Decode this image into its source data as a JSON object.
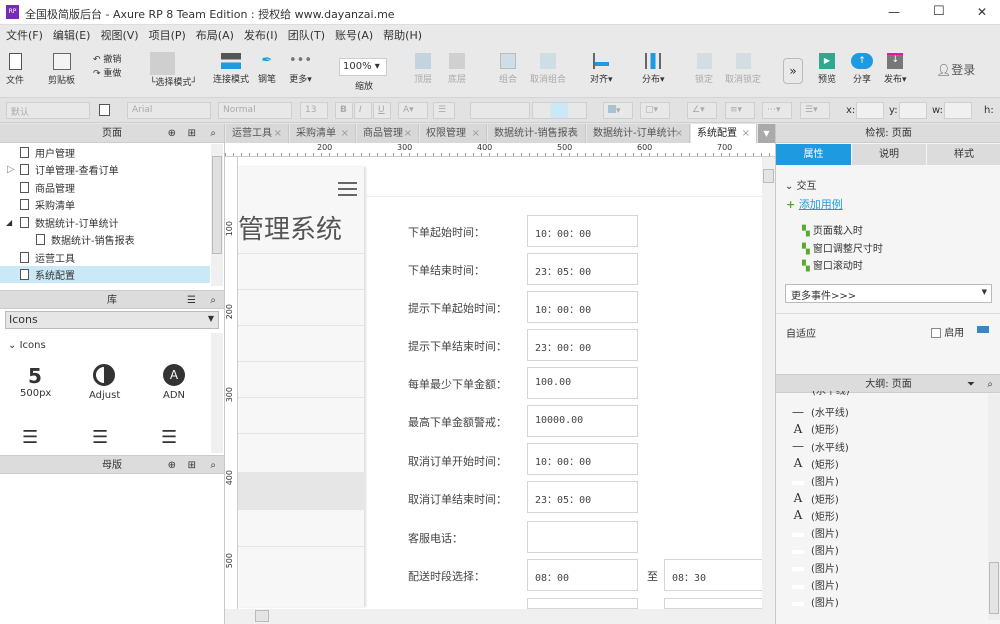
{
  "window": {
    "title": "全国极简版后台 - Axure RP 8 Team Edition : 授权给 www.dayanzai.me",
    "minimize": "—",
    "maximize": "☐",
    "close": "✕"
  },
  "menu": [
    "文件(F)",
    "编辑(E)",
    "视图(V)",
    "项目(P)",
    "布局(A)",
    "发布(I)",
    "团队(T)",
    "账号(A)",
    "帮助(H)"
  ],
  "toolbar": {
    "file": "文件",
    "clipboard": "剪贴板",
    "undo": "撤销",
    "redo": "重做",
    "select_mode": "选择模式",
    "connect_mode": "连接模式",
    "pen": "钢笔",
    "more": "更多▾",
    "zoom_value": "100%",
    "zoom": "缩放",
    "top": "顶层",
    "bottom": "底层",
    "group": "组合",
    "ungroup": "取消组合",
    "align": "对齐▾",
    "distribute": "分布▾",
    "lock": "锁定",
    "unlock": "取消锁定",
    "preview": "预览",
    "share": "分享",
    "publish": "发布▾",
    "login": "登录"
  },
  "format": {
    "style": "默认",
    "font": "Arial",
    "weight": "Normal",
    "size": "13",
    "x": "x:",
    "y": "y:",
    "w": "w:",
    "h": "h:"
  },
  "pages": {
    "title": "页面",
    "items": [
      "用户管理",
      "订单管理-查看订单",
      "商品管理",
      "采购清单",
      "数据统计-订单统计",
      "数据统计-销售报表",
      "运营工具",
      "系统配置"
    ]
  },
  "library": {
    "title": "库",
    "selected": "Icons",
    "group": "Icons",
    "icons": [
      "500px",
      "Adjust",
      "ADN"
    ]
  },
  "masters": {
    "title": "母版"
  },
  "tabs": [
    "运营工具",
    "采购清单",
    "商品管理",
    "权限管理",
    "数据统计-销售报表",
    "数据统计-订单统计",
    "系统配置"
  ],
  "ruler": {
    "h": [
      "200",
      "300",
      "400",
      "500",
      "600",
      "700"
    ],
    "v": [
      "100",
      "200",
      "300",
      "400",
      "500"
    ]
  },
  "canvas": {
    "sidebar_title": "管理系统",
    "form": [
      {
        "label": "下单起始时间：",
        "value": "10：00：00"
      },
      {
        "label": "下单结束时间：",
        "value": "23：05：00"
      },
      {
        "label": "提示下单起始时间：",
        "value": "10：00：00"
      },
      {
        "label": "提示下单结束时间：",
        "value": "23：00：00"
      },
      {
        "label": "每单最少下单金额：",
        "value": "100.00"
      },
      {
        "label": "最高下单金额警戒：",
        "value": "10000.00"
      },
      {
        "label": "取消订单开始时间：",
        "value": "10：00：00"
      },
      {
        "label": "取消订单结束时间：",
        "value": "23：05：00"
      },
      {
        "label": "客服电话：",
        "value": ""
      },
      {
        "label": "配送时段选择：",
        "value": "08：00",
        "to": "至",
        "value2": "08：30"
      }
    ]
  },
  "inspector": {
    "title": "检视: 页面",
    "tabs": [
      "属性",
      "说明",
      "样式"
    ],
    "interaction": "交互",
    "add_case": "添加用例",
    "events": [
      "页面载入时",
      "窗口调整尺寸时",
      "窗口滚动时"
    ],
    "more_events": "更多事件>>>",
    "adaptive": "自适应",
    "enable": "启用",
    "accent": "#1e9be0"
  },
  "outline": {
    "title": "大纲: 页面",
    "partial": "(水平线)",
    "items": [
      {
        "icon": "line",
        "label": "(水平线)"
      },
      {
        "icon": "A",
        "label": "(矩形)"
      },
      {
        "icon": "line",
        "label": "(水平线)"
      },
      {
        "icon": "A",
        "label": "(矩形)"
      },
      {
        "icon": "img",
        "label": "(图片)"
      },
      {
        "icon": "A",
        "label": "(矩形)"
      },
      {
        "icon": "A",
        "label": "(矩形)"
      },
      {
        "icon": "img",
        "label": "(图片)"
      },
      {
        "icon": "img",
        "label": "(图片)"
      },
      {
        "icon": "img",
        "label": "(图片)"
      },
      {
        "icon": "img",
        "label": "(图片)"
      },
      {
        "icon": "img",
        "label": "(图片)"
      }
    ]
  }
}
